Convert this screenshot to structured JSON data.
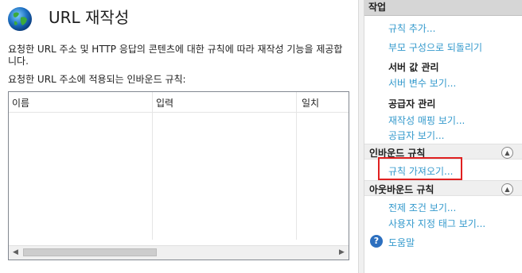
{
  "page": {
    "title": "URL 재작성",
    "description": "요청한 URL 주소 및 HTTP 응답의 콘텐츠에 대한 규칙에 따라 재작성 기능을 제공합니다.",
    "inbound_label": "요청한 URL 주소에 적용되는 인바운드 규칙:"
  },
  "grid": {
    "columns": [
      "이름",
      "입력",
      "일치"
    ],
    "rows": []
  },
  "actions": {
    "header": "작업",
    "add_rule": "규칙 추가...",
    "revert_parent": "부모 구성으로 되돌리기",
    "server_vars_group": "서버 값 관리",
    "server_vars_view": "서버 변수 보기...",
    "providers_group": "공급자 관리",
    "rewrite_maps_view": "재작성 매핑 보기...",
    "providers_view": "공급자 보기...",
    "inbound_section": "인바운드 규칙",
    "import_rules": "규칙 가져오기...",
    "outbound_section": "아웃바운드 규칙",
    "preconditions_view": "전제 조건 보기...",
    "custom_tags_view": "사용자 지정 태그 보기...",
    "help": "도움말"
  },
  "icons": {
    "globe": "globe-icon",
    "collapse": "chevron-up-circle-icon",
    "help": "help-icon"
  },
  "colors": {
    "link": "#3399cc",
    "highlight": "#e02020",
    "header_bg": "#d6d6d6"
  }
}
